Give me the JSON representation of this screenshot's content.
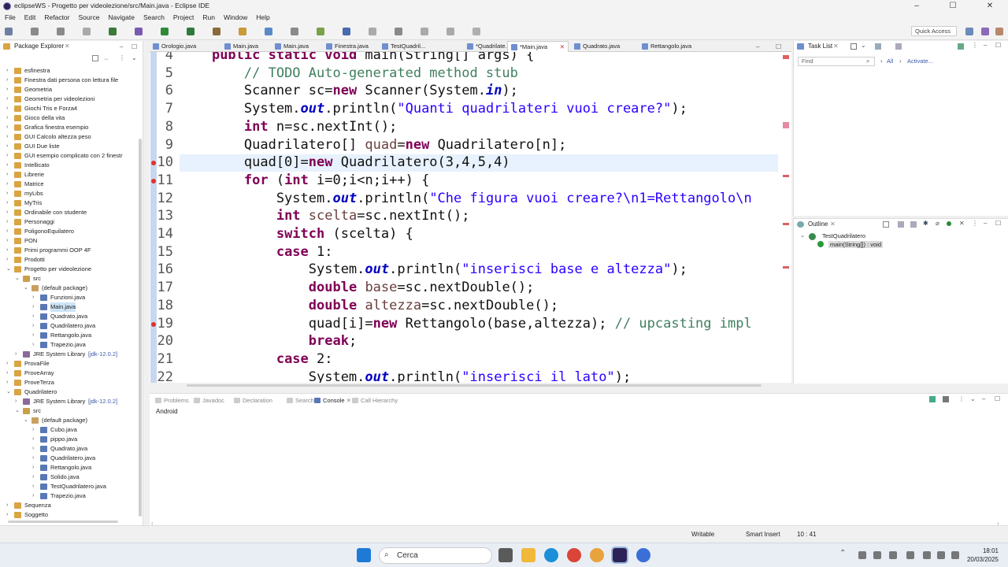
{
  "window": {
    "title": "eclipseWS - Progetto per videolezione/src/Main.java - Eclipse IDE"
  },
  "menu": [
    "File",
    "Edit",
    "Refactor",
    "Source",
    "Navigate",
    "Search",
    "Project",
    "Run",
    "Window",
    "Help"
  ],
  "toolbar": {
    "quick_access": "Quick Access"
  },
  "package_explorer": {
    "title": "Package Explorer",
    "items": [
      {
        "label": "esfinestra",
        "depth": 0,
        "arrow": "›"
      },
      {
        "label": "Finestra dati persona con lettura file",
        "depth": 0,
        "arrow": "›"
      },
      {
        "label": "Geometria",
        "depth": 0,
        "arrow": "›"
      },
      {
        "label": "Geometria per videolezioni",
        "depth": 0,
        "arrow": "›"
      },
      {
        "label": "Giochi Tris e Forza4",
        "depth": 0,
        "arrow": "›"
      },
      {
        "label": "Gioco della vita",
        "depth": 0,
        "arrow": "›"
      },
      {
        "label": "Grafica finestra esempio",
        "depth": 0,
        "arrow": "›"
      },
      {
        "label": "GUI Calcolo altezza peso",
        "depth": 0,
        "arrow": "›"
      },
      {
        "label": "GUI Due liste",
        "depth": 0,
        "arrow": "›"
      },
      {
        "label": "GUI esempio complicato con 2 finestr",
        "depth": 0,
        "arrow": "›"
      },
      {
        "label": "Intellicato",
        "depth": 0,
        "arrow": "›"
      },
      {
        "label": "Librerie",
        "depth": 0,
        "arrow": "›"
      },
      {
        "label": "Matrice",
        "depth": 0,
        "arrow": "›"
      },
      {
        "label": "myLibs",
        "depth": 0,
        "arrow": "›"
      },
      {
        "label": "MyTris",
        "depth": 0,
        "arrow": "›"
      },
      {
        "label": "Ordinabile con studente",
        "depth": 0,
        "arrow": "›"
      },
      {
        "label": "Personaggi",
        "depth": 0,
        "arrow": "›"
      },
      {
        "label": "PoligonoEquilatero",
        "depth": 0,
        "arrow": "›"
      },
      {
        "label": "PON",
        "depth": 0,
        "arrow": "›"
      },
      {
        "label": "Primi programmi OOP 4F",
        "depth": 0,
        "arrow": "›"
      },
      {
        "label": "Prodotti",
        "depth": 0,
        "arrow": "›"
      },
      {
        "label": "Progetto per videolezione",
        "depth": 0,
        "arrow": "⌄"
      },
      {
        "label": "src",
        "depth": 1,
        "arrow": "⌄"
      },
      {
        "label": "(default package)",
        "depth": 2,
        "arrow": "⌄"
      },
      {
        "label": "Funzioni.java",
        "depth": 3,
        "arrow": "›"
      },
      {
        "label": "Main.java",
        "depth": 3,
        "arrow": "›",
        "selected": true
      },
      {
        "label": "Quadrato.java",
        "depth": 3,
        "arrow": "›"
      },
      {
        "label": "Quadrilatero.java",
        "depth": 3,
        "arrow": "›"
      },
      {
        "label": "Rettangolo.java",
        "depth": 3,
        "arrow": "›"
      },
      {
        "label": "Trapezio.java",
        "depth": 3,
        "arrow": "›"
      },
      {
        "label": "JRE System Library",
        "suffix": "[jdk-12.0.2]",
        "depth": 1,
        "arrow": "›"
      },
      {
        "label": "ProvaFile",
        "depth": 0,
        "arrow": "›"
      },
      {
        "label": "ProveArray",
        "depth": 0,
        "arrow": "›"
      },
      {
        "label": "ProveTerza",
        "depth": 0,
        "arrow": "›"
      },
      {
        "label": "Quadrilatero",
        "depth": 0,
        "arrow": "⌄"
      },
      {
        "label": "JRE System Library",
        "suffix": "[jdk-12.0.2]",
        "depth": 1,
        "arrow": "›"
      },
      {
        "label": "src",
        "depth": 1,
        "arrow": "⌄"
      },
      {
        "label": "(default package)",
        "depth": 2,
        "arrow": "⌄"
      },
      {
        "label": "Cubo.java",
        "depth": 3,
        "arrow": "›"
      },
      {
        "label": "pippo.java",
        "depth": 3,
        "arrow": "›"
      },
      {
        "label": "Quadrato.java",
        "depth": 3,
        "arrow": "›"
      },
      {
        "label": "Quadrilatero.java",
        "depth": 3,
        "arrow": "›"
      },
      {
        "label": "Rettangolo.java",
        "depth": 3,
        "arrow": "›"
      },
      {
        "label": "Solido.java",
        "depth": 3,
        "arrow": "›"
      },
      {
        "label": "TestQuadrilatero.java",
        "depth": 3,
        "arrow": "›"
      },
      {
        "label": "Trapezio.java",
        "depth": 3,
        "arrow": "›"
      },
      {
        "label": "Sequenza",
        "depth": 0,
        "arrow": "›"
      },
      {
        "label": "Soggetto",
        "depth": 0,
        "arrow": "›"
      }
    ]
  },
  "editor_tabs": [
    {
      "label": "Orologio.java"
    },
    {
      "label": "Main.java"
    },
    {
      "label": "Main.java"
    },
    {
      "label": "Finestra.java"
    },
    {
      "label": "TestQuadril..."
    },
    {
      "label": "*Quadrilate..."
    },
    {
      "label": "*Main.java",
      "active": true
    },
    {
      "label": "Quadrato.java"
    },
    {
      "label": "Rettangolo.java"
    }
  ],
  "code_lines": [
    {
      "n": "4",
      "html": "    <span class='kw'>public static void</span> main(String[] args) {"
    },
    {
      "n": "5",
      "html": "        <span class='cm'>// TODO Auto-generated method stub</span>"
    },
    {
      "n": "6",
      "html": "        Scanner sc=<span class='kw'>new</span> Scanner(System.<span class='fi'>in</span>);"
    },
    {
      "n": "7",
      "html": "        System.<span class='fi'>out</span>.println(<span class='st'>\"Quanti quadrilateri vuoi creare?\"</span>);"
    },
    {
      "n": "8",
      "html": "        <span class='kw'>int</span> n=sc.nextInt();"
    },
    {
      "n": "9",
      "html": "        Quadrilatero[] <span class='var'>quad</span>=<span class='kw'>new</span> Quadrilatero[n];"
    },
    {
      "n": "10",
      "html": "        quad[0]=<span class='kw'>new</span> Quadrilatero(3,4,5,4)",
      "current": true,
      "error": true
    },
    {
      "n": "11",
      "html": "        <span class='kw'>for</span> (<span class='kw'>int</span> i=0;i&lt;n;i++) {",
      "error": true
    },
    {
      "n": "12",
      "html": "            System.<span class='fi'>out</span>.println(<span class='st'>\"Che figura vuoi creare?\\n1=Rettangolo\\n</span>"
    },
    {
      "n": "13",
      "html": "            <span class='kw'>int</span> <span class='var'>scelta</span>=sc.nextInt();"
    },
    {
      "n": "14",
      "html": "            <span class='kw'>switch</span> (scelta) {"
    },
    {
      "n": "15",
      "html": "            <span class='kw'>case</span> 1:"
    },
    {
      "n": "16",
      "html": "                System.<span class='fi'>out</span>.println(<span class='st'>\"inserisci base e altezza\"</span>);"
    },
    {
      "n": "17",
      "html": "                <span class='kw'>double</span> <span class='var'>base</span>=sc.nextDouble();"
    },
    {
      "n": "18",
      "html": "                <span class='kw'>double</span> <span class='var'>altezza</span>=sc.nextDouble();"
    },
    {
      "n": "19",
      "html": "                quad[i]=<span class='kw'>new</span> Rettangolo(base,altezza); <span class='cm'>// upcasting impl</span>",
      "error": true
    },
    {
      "n": "20",
      "html": "                <span class='kw'>break</span>;"
    },
    {
      "n": "21",
      "html": "            <span class='kw'>case</span> 2:"
    },
    {
      "n": "22",
      "html": "                System.<span class='fi'>out</span>.println(<span class='st'>\"inserisci il lato\"</span>);"
    }
  ],
  "task_list": {
    "title": "Task List",
    "find_placeholder": "Find",
    "all": "All",
    "activate": "Activate..."
  },
  "outline": {
    "title": "Outline",
    "class_name": "TestQuadrilatero",
    "method": "main(String[]) : void"
  },
  "console_tabs": [
    {
      "label": "Problems"
    },
    {
      "label": "Javadoc"
    },
    {
      "label": "Declaration"
    },
    {
      "label": "Search"
    },
    {
      "label": "Console",
      "active": true
    },
    {
      "label": "Call Hierarchy"
    }
  ],
  "console": {
    "content": "Android"
  },
  "status": {
    "writable": "Writable",
    "insert_mode": "Smart Insert",
    "position": "10 : 41"
  },
  "taskbar": {
    "search_placeholder": "Cerca",
    "time": "18:01",
    "date": "20/03/2025"
  }
}
